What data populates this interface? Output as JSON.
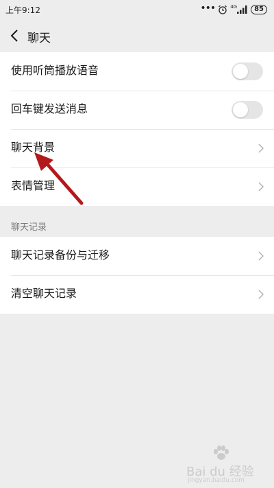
{
  "status_bar": {
    "time": "上午9:12",
    "icons": [
      "more-dots-icon",
      "alarm-icon",
      "signal-4g-icon",
      "battery-icon"
    ],
    "network_label": "4G",
    "battery_level": "85"
  },
  "header": {
    "title": "聊天",
    "back_icon": "chevron-left-icon"
  },
  "settings": {
    "items": [
      {
        "label": "使用听筒播放语音",
        "control": "toggle",
        "enabled": false
      },
      {
        "label": "回车键发送消息",
        "control": "toggle",
        "enabled": false
      },
      {
        "label": "聊天背景",
        "control": "chevron"
      },
      {
        "label": "表情管理",
        "control": "chevron"
      }
    ]
  },
  "chat_history": {
    "section_title": "聊天记录",
    "items": [
      {
        "label": "聊天记录备份与迁移",
        "control": "chevron"
      },
      {
        "label": "清空聊天记录",
        "control": "chevron"
      }
    ]
  },
  "annotation": {
    "icon": "red-arrow-icon",
    "color": "#b3191c",
    "points_to": "聊天背景"
  },
  "watermark": {
    "text": "Bai du 经验",
    "sub": "jingyan.baidu.com"
  },
  "colors": {
    "background": "#ededed",
    "card": "#ffffff",
    "toggle_off": "#e5e5e5",
    "divider": "#e6e6e6",
    "section_text": "#7a7a7a"
  }
}
